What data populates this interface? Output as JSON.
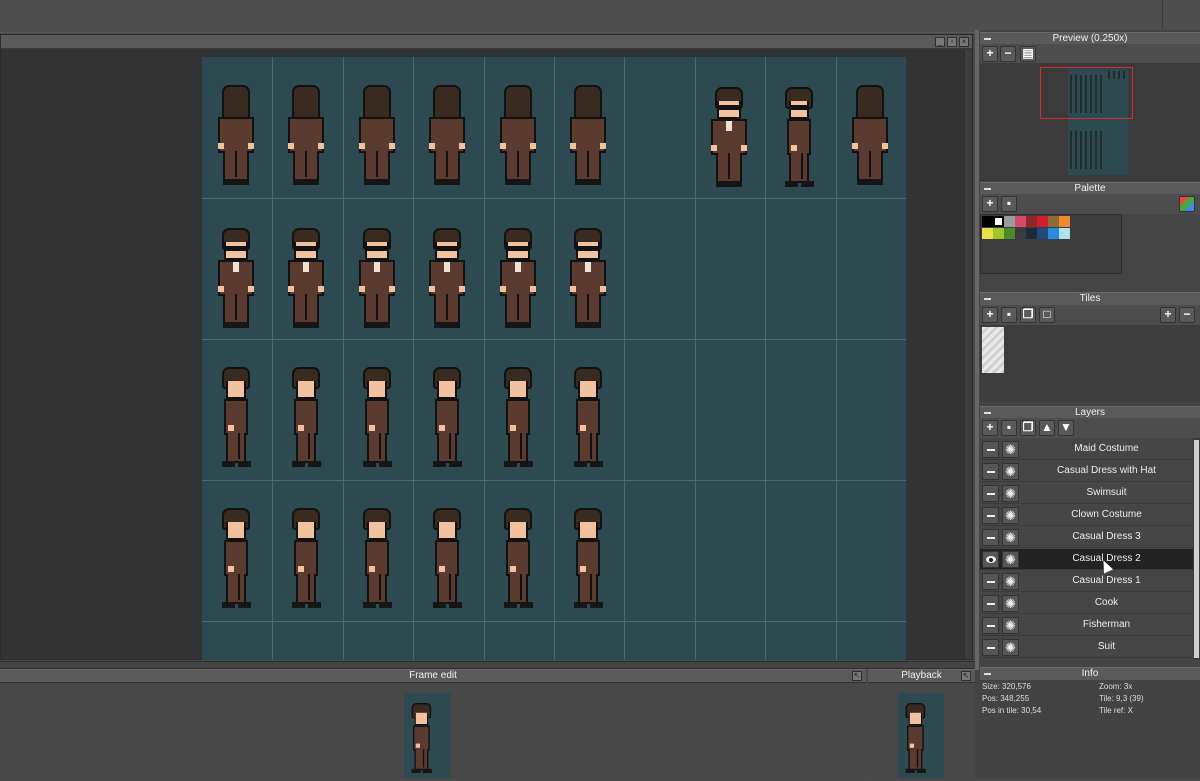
{
  "preview": {
    "title": "Preview (0.250x)"
  },
  "palette": {
    "title": "Palette",
    "colors": [
      "#000000",
      "#ffffff",
      "#9b9b9b",
      "#d94a6a",
      "#8a2a2a",
      "#d01f2b",
      "#8f6b3a",
      "#f08a2a",
      "#e8e04a",
      "#9ec52a",
      "#4a8a2a",
      "#3b3b3b",
      "#1d2a3a",
      "#1f4a7a",
      "#2a8ae0",
      "#aee0f0"
    ]
  },
  "tiles": {
    "title": "Tiles"
  },
  "layers": {
    "title": "Layers",
    "items": [
      {
        "name": "Maid Costume",
        "visible": false
      },
      {
        "name": "Casual Dress with Hat",
        "visible": false
      },
      {
        "name": "Swimsuit",
        "visible": false
      },
      {
        "name": "Clown Costume",
        "visible": false
      },
      {
        "name": "Casual Dress 3",
        "visible": false
      },
      {
        "name": "Casual Dress 2",
        "visible": true,
        "selected": true
      },
      {
        "name": "Casual Dress 1",
        "visible": false
      },
      {
        "name": "Cook",
        "visible": false
      },
      {
        "name": "Fisherman",
        "visible": false
      },
      {
        "name": "Suit",
        "visible": false
      }
    ]
  },
  "frame_edit": {
    "title": "Frame edit"
  },
  "playback": {
    "title": "Playback"
  },
  "info": {
    "title": "Info",
    "size": "Size: 320,576",
    "zoom": "Zoom: 3x",
    "pos": "Pos: 348,255",
    "tile": "Tile: 9,3 (39)",
    "pos_in_tile": "Pos in tile: 30,54",
    "tile_ref": "Tile ref: X"
  }
}
